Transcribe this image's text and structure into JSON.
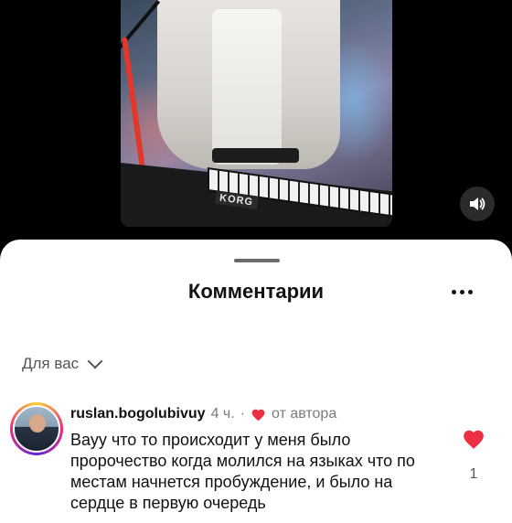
{
  "sheet": {
    "title": "Комментарии"
  },
  "filter": {
    "label": "Для вас"
  },
  "comment": {
    "username": "ruslan.bogolubivuy",
    "time": "4 ч.",
    "separator": "·",
    "author_tag": "от автора",
    "text": "Вауу что то происходит у меня было пророчество когда молился на языках что по местам начнется пробуждение, и было на сердце в первую очередь",
    "like_count": "1"
  },
  "video": {
    "brand_text": "KORG"
  },
  "colors": {
    "heart": "#ed2f43",
    "sheet_bg": "#ffffff",
    "background": "#000000"
  },
  "icons": {
    "volume": "volume-icon",
    "more": "more-dots-icon",
    "chevron": "chevron-down-icon",
    "heart": "heart-icon"
  }
}
